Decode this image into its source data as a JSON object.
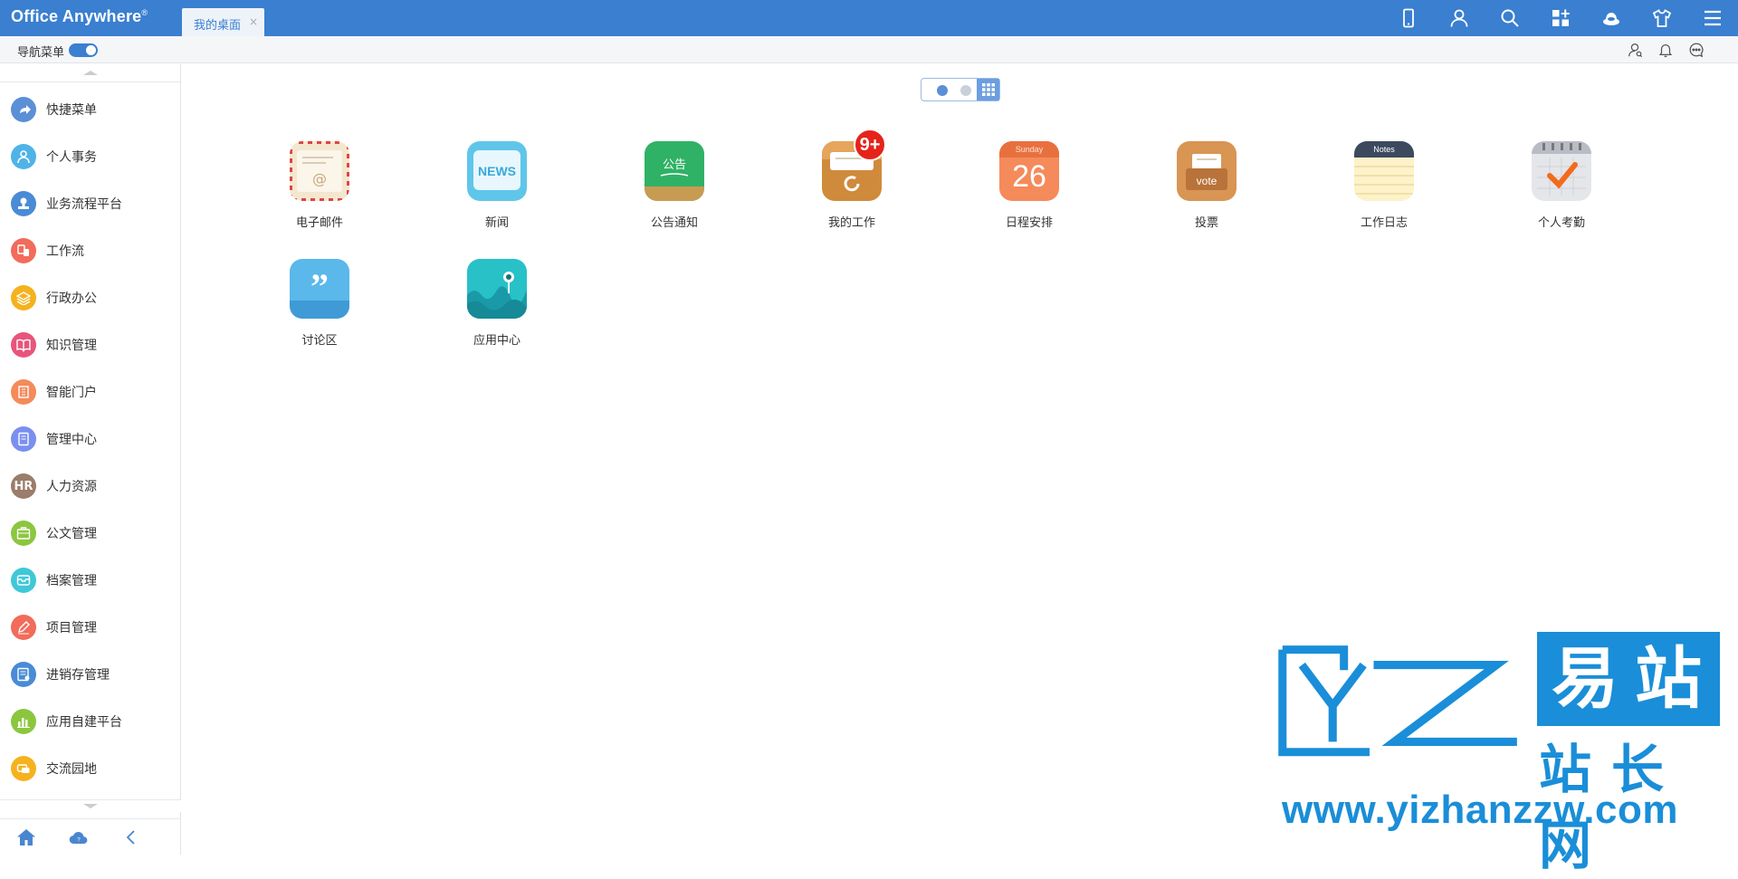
{
  "header": {
    "logo": "Office Anywhere",
    "logo_mark": "®",
    "active_tab": "我的桌面",
    "tab_close": "×",
    "icons": [
      "mobile-icon",
      "user-icon",
      "search-icon",
      "apps-icon",
      "skin-icon",
      "shirt-icon",
      "menu-icon"
    ]
  },
  "subbar": {
    "nav_label": "导航菜单",
    "nav_enabled": true,
    "icons": [
      "contacts-icon",
      "bell-icon",
      "chat-icon"
    ]
  },
  "sidebar": {
    "items": [
      {
        "label": "快捷菜单",
        "color": "#5b8fd6",
        "icon": "share-icon"
      },
      {
        "label": "个人事务",
        "color": "#4fb3e8",
        "icon": "person-icon"
      },
      {
        "label": "业务流程平台",
        "color": "#4a8bd6",
        "icon": "stamp-icon"
      },
      {
        "label": "工作流",
        "color": "#f26b5b",
        "icon": "workflow-icon"
      },
      {
        "label": "行政办公",
        "color": "#f5b21e",
        "icon": "layers-icon"
      },
      {
        "label": "知识管理",
        "color": "#e8557b",
        "icon": "book-icon"
      },
      {
        "label": "智能门户",
        "color": "#f58a5b",
        "icon": "building-icon"
      },
      {
        "label": "管理中心",
        "color": "#7b8ff0",
        "icon": "document-icon"
      },
      {
        "label": "人力资源",
        "color": "#9a7d6a",
        "icon": "hr-icon",
        "text": "HR"
      },
      {
        "label": "公文管理",
        "color": "#8cc63f",
        "icon": "briefcase-icon"
      },
      {
        "label": "档案管理",
        "color": "#3fc8d8",
        "icon": "archive-icon"
      },
      {
        "label": "项目管理",
        "color": "#f26b5b",
        "icon": "pencil-icon"
      },
      {
        "label": "进销存管理",
        "color": "#4a8bd6",
        "icon": "form-icon"
      },
      {
        "label": "应用自建平台",
        "color": "#8cc63f",
        "icon": "chart-icon"
      },
      {
        "label": "交流园地",
        "color": "#f5b21e",
        "icon": "chat-bubble-icon"
      }
    ],
    "footer": [
      "home-icon",
      "cloud-icon",
      "collapse-icon"
    ]
  },
  "desktop": {
    "pages": 2,
    "current_page": 1,
    "apps": [
      {
        "label": "电子邮件",
        "icon": "mail-icon"
      },
      {
        "label": "新闻",
        "icon": "news-icon",
        "icon_text": "NEWS"
      },
      {
        "label": "公告通知",
        "icon": "notice-icon",
        "icon_text": "公告"
      },
      {
        "label": "我的工作",
        "icon": "work-icon",
        "badge": "9+"
      },
      {
        "label": "日程安排",
        "icon": "calendar-icon",
        "icon_text": "Sunday",
        "icon_number": "26"
      },
      {
        "label": "投票",
        "icon": "vote-icon",
        "icon_text": "vote"
      },
      {
        "label": "工作日志",
        "icon": "notes-icon",
        "icon_text": "Notes"
      },
      {
        "label": "个人考勤",
        "icon": "attendance-icon"
      },
      {
        "label": "讨论区",
        "icon": "forum-icon"
      },
      {
        "label": "应用中心",
        "icon": "app-center-icon"
      }
    ]
  },
  "watermark": {
    "cn_big": "易站",
    "cn_small": "站长网",
    "url": "www.yizhanzzw.com"
  }
}
